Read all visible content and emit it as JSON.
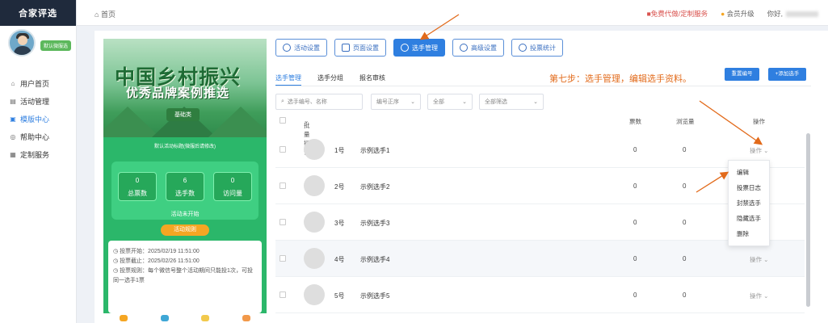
{
  "brand": {
    "logo": "合家评选"
  },
  "user": {
    "badge": "默认微服选"
  },
  "sidebar": {
    "items": [
      {
        "label": "用户首页",
        "icon": "home-icon"
      },
      {
        "label": "活动管理",
        "icon": "list-icon"
      },
      {
        "label": "模版中心",
        "icon": "template-icon",
        "active": true
      },
      {
        "label": "帮助中心",
        "icon": "help-icon"
      },
      {
        "label": "定制服务",
        "icon": "grid-icon"
      }
    ]
  },
  "topbar": {
    "breadcrumb": "首页",
    "free_service": "免费代做/定制服务",
    "vip": "会员升级",
    "greeting": "你好,"
  },
  "preview": {
    "title_line1": "中国乡村振兴",
    "title_line2": "优秀品牌案例推选",
    "tag": "基础类",
    "subtitle": "默认活动标题(微服后请修改)",
    "stats": [
      {
        "value": "0",
        "label": "总票数"
      },
      {
        "value": "6",
        "label": "选手数"
      },
      {
        "value": "0",
        "label": "访问量"
      }
    ],
    "status": "活动未开始",
    "rules_button": "活动规则",
    "vote_start": "投票开始：2025/02/19 11:51:00",
    "vote_end": "投票截止：2025/02/26 11:51:00",
    "vote_rule": "投票规则：每个微信号整个活动期间只能投1次，可投同一选手1票"
  },
  "toolbar": {
    "buttons": [
      {
        "label": "活动设置",
        "icon": "settings-icon"
      },
      {
        "label": "页面设置",
        "icon": "page-icon"
      },
      {
        "label": "选手管理",
        "icon": "users-icon",
        "active": true
      },
      {
        "label": "高级设置",
        "icon": "advanced-icon"
      },
      {
        "label": "投票统计",
        "icon": "stats-icon"
      }
    ]
  },
  "tabs": [
    "选手管理",
    "选手分组",
    "报名审核"
  ],
  "step_note": "第七步：选手管理，编辑选手资料。",
  "actions": {
    "reorder": "重置编号",
    "add": "+添加选手"
  },
  "filters": {
    "search_placeholder": "选手编号、名称",
    "sort": "编号正序",
    "group": "全部",
    "status": "全部筛选"
  },
  "table": {
    "headers": {
      "batch": "批量操作",
      "votes": "票数",
      "views": "浏览量",
      "ops": "操作"
    },
    "rows": [
      {
        "num": "1号",
        "name": "示例选手1",
        "votes": "0",
        "views": "0",
        "op": "操作"
      },
      {
        "num": "2号",
        "name": "示例选手2",
        "votes": "0",
        "views": "0",
        "op": "操作"
      },
      {
        "num": "3号",
        "name": "示例选手3",
        "votes": "0",
        "views": "0",
        "op": "操作"
      },
      {
        "num": "4号",
        "name": "示例选手4",
        "votes": "0",
        "views": "0",
        "op": "操作"
      },
      {
        "num": "5号",
        "name": "示例选手5",
        "votes": "0",
        "views": "0",
        "op": "操作"
      }
    ]
  },
  "dropdown": [
    "编辑",
    "投票日志",
    "封禁选手",
    "隐藏选手",
    "删除"
  ],
  "colors": {
    "primary": "#2f7fe0",
    "note": "#e26a1a",
    "arrow": "#e26a1a",
    "phone_bg": "#2bb76a"
  }
}
